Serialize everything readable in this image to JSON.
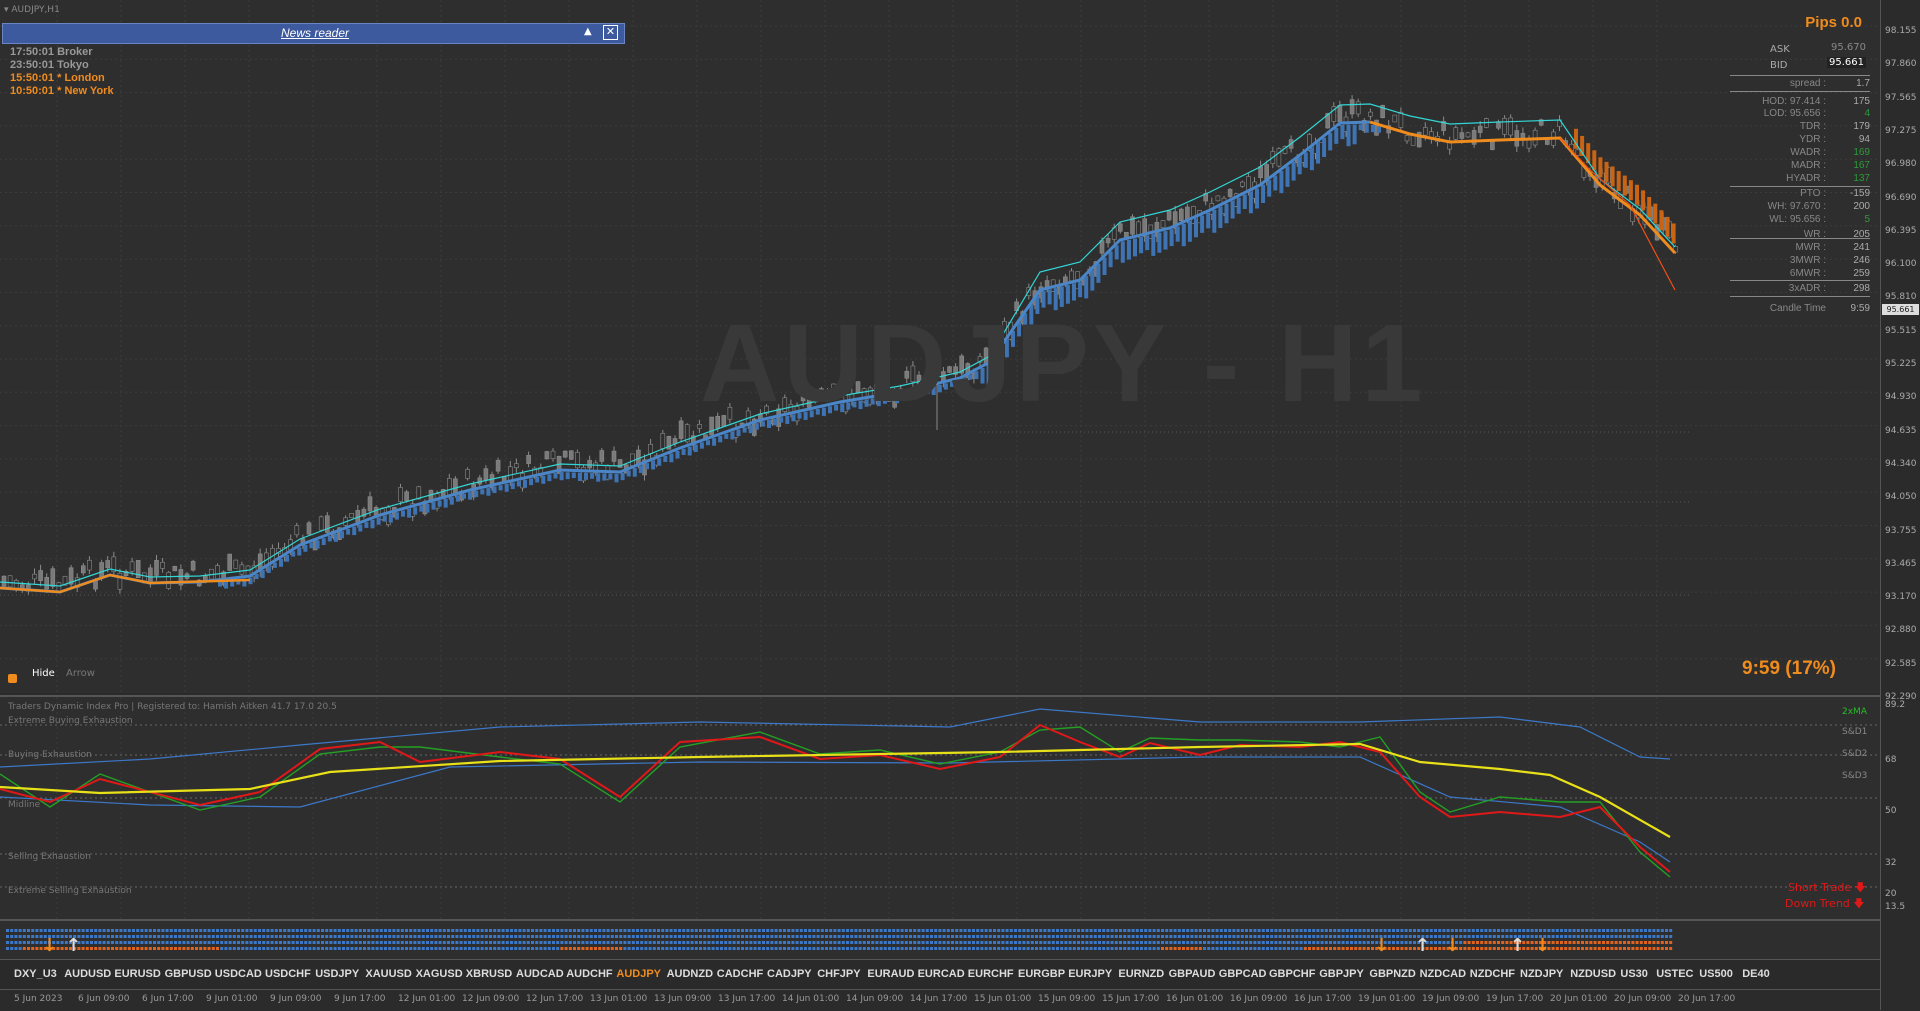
{
  "window": {
    "title": "AUDJPY,H1",
    "watermark": "AUDJPY - H1"
  },
  "news_reader": {
    "title": "News reader"
  },
  "sessions": [
    {
      "time": "17:50:01",
      "name": "Broker",
      "color": "#999999"
    },
    {
      "time": "23:50:01",
      "name": "Tokyo",
      "color": "#999999"
    },
    {
      "time": "15:50:01",
      "name": "* London",
      "color": "#f08c1e"
    },
    {
      "time": "10:50:01",
      "name": "* New York",
      "color": "#f08c1e"
    }
  ],
  "pips": "Pips 0.0",
  "ask": {
    "label": "ASK",
    "value": "95.670"
  },
  "bid": {
    "label": "BID",
    "value": "95.661"
  },
  "stats": [
    {
      "k": "spread :",
      "v": "1.7",
      "vc": "#aaaaaa"
    },
    {
      "k": "HOD: 97.414 :",
      "v": "175",
      "vc": "#aaaaaa"
    },
    {
      "k": "LOD: 95.656 :",
      "v": "4",
      "vc": "#2e9a3a"
    },
    {
      "k": "TDR :",
      "v": "179",
      "vc": "#aaaaaa"
    },
    {
      "k": "YDR :",
      "v": "94",
      "vc": "#aaaaaa"
    },
    {
      "k": "WADR :",
      "v": "169",
      "vc": "#2e9a3a"
    },
    {
      "k": "MADR :",
      "v": "167",
      "vc": "#2e9a3a"
    },
    {
      "k": "HYADR :",
      "v": "137",
      "vc": "#2e9a3a"
    },
    {
      "k": "PTO :",
      "v": "-159",
      "vc": "#aaaaaa"
    },
    {
      "k": "WH: 97.670 :",
      "v": "200",
      "vc": "#aaaaaa"
    },
    {
      "k": "WL: 95.656 :",
      "v": "5",
      "vc": "#2e9a3a"
    },
    {
      "k": "WR :",
      "v": "205",
      "vc": "#aaaaaa"
    },
    {
      "k": "MWR :",
      "v": "241",
      "vc": "#aaaaaa"
    },
    {
      "k": "3MWR :",
      "v": "246",
      "vc": "#aaaaaa"
    },
    {
      "k": "6MWR :",
      "v": "259",
      "vc": "#aaaaaa"
    },
    {
      "k": "3xADR :",
      "v": "298",
      "vc": "#aaaaaa"
    },
    {
      "k": "Candle Time",
      "v": "9:59",
      "vc": "#aaaaaa"
    }
  ],
  "candle_timer": "9:59 (17%)",
  "toggles": {
    "hide": "Hide",
    "arrow": "Arrow"
  },
  "price_axis": [
    "98.155",
    "97.860",
    "97.565",
    "97.275",
    "96.980",
    "96.690",
    "96.395",
    "96.100",
    "95.810",
    "95.515",
    "95.225",
    "94.930",
    "94.635",
    "94.340",
    "94.050",
    "93.755",
    "93.465",
    "93.170",
    "92.880",
    "92.585",
    "92.290"
  ],
  "current_price": "95.661",
  "indicator": {
    "header": "Traders Dynamic Index Pro | Registered to: Hamish Aitken 41.7 17.0 20.5",
    "zones": [
      "Extreme Buying Exhaustion",
      "Buying Exhaustion",
      "Selling Exhaustion",
      "Extreme Selling Exhaustion"
    ],
    "midline": "Midline",
    "ma_label": "2xMA",
    "sd_labels": [
      "S&D1",
      "S&D2",
      "S&D3"
    ],
    "axis": [
      "89.2",
      "68",
      "50",
      "32",
      "20",
      "13.5"
    ],
    "signals": [
      "Short Trade",
      "Down Trend"
    ]
  },
  "symbols": [
    "DXY_U3",
    "AUDUSD",
    "EURUSD",
    "GBPUSD",
    "USDCAD",
    "USDCHF",
    "USDJPY",
    "XAUUSD",
    "XAGUSD",
    "XBRUSD",
    "AUDCAD",
    "AUDCHF",
    "AUDJPY",
    "AUDNZD",
    "CADCHF",
    "CADJPY",
    "CHFJPY",
    "EURAUD",
    "EURCAD",
    "EURCHF",
    "EURGBP",
    "EURJPY",
    "EURNZD",
    "GBPAUD",
    "GBPCAD",
    "GBPCHF",
    "GBPJPY",
    "GBPNZD",
    "NZDCAD",
    "NZDCHF",
    "NZDJPY",
    "NZDUSD",
    "US30",
    "USTEC",
    "US500",
    "DE40"
  ],
  "active_symbol": "AUDJPY",
  "time_axis": [
    "5 Jun 2023",
    "6 Jun 09:00",
    "6 Jun 17:00",
    "9 Jun 01:00",
    "9 Jun 09:00",
    "9 Jun 17:00",
    "12 Jun 01:00",
    "12 Jun 09:00",
    "12 Jun 17:00",
    "13 Jun 01:00",
    "13 Jun 09:00",
    "13 Jun 17:00",
    "14 Jun 01:00",
    "14 Jun 09:00",
    "14 Jun 17:00",
    "15 Jun 01:00",
    "15 Jun 09:00",
    "15 Jun 17:00",
    "16 Jun 01:00",
    "16 Jun 09:00",
    "16 Jun 17:00",
    "19 Jun 01:00",
    "19 Jun 09:00",
    "19 Jun 17:00",
    "20 Jun 01:00",
    "20 Jun 09:00",
    "20 Jun 17:00"
  ],
  "colors": {
    "accent_orange": "#f08c1e",
    "ma_blue": "#4a86c8",
    "cyan": "#33d6d6",
    "tdi_red": "#e01818",
    "tdi_green": "#23a023",
    "tdi_yellow": "#e8e018"
  }
}
